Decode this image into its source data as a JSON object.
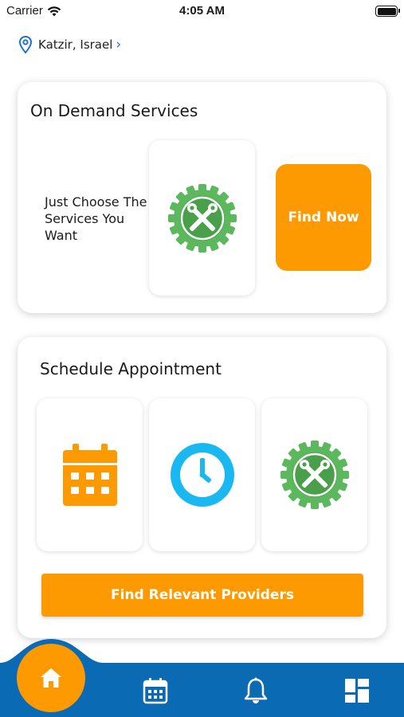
{
  "status_bar": {
    "carrier": "Carrier",
    "time": "4:05 AM"
  },
  "location": {
    "label": "Katzir, Israel"
  },
  "on_demand": {
    "title": "On Demand Services",
    "tagline": "Just Choose The Services You Want",
    "find_now_label": "Find Now"
  },
  "schedule": {
    "title": "Schedule Appointment",
    "find_providers_label": "Find Relevant Providers"
  },
  "icons": {
    "location": "location-pin-icon",
    "service": "gear-wrench-icon",
    "calendar": "calendar-icon",
    "clock": "clock-icon",
    "home": "home-icon",
    "bell": "bell-icon",
    "dashboard": "dashboard-icon"
  },
  "colors": {
    "accent": "#fd9a02",
    "tabbar": "#0a6ab4",
    "gear_green": "#5cb85c",
    "clock_blue": "#1ab8f0",
    "link": "#1f6fd6"
  }
}
